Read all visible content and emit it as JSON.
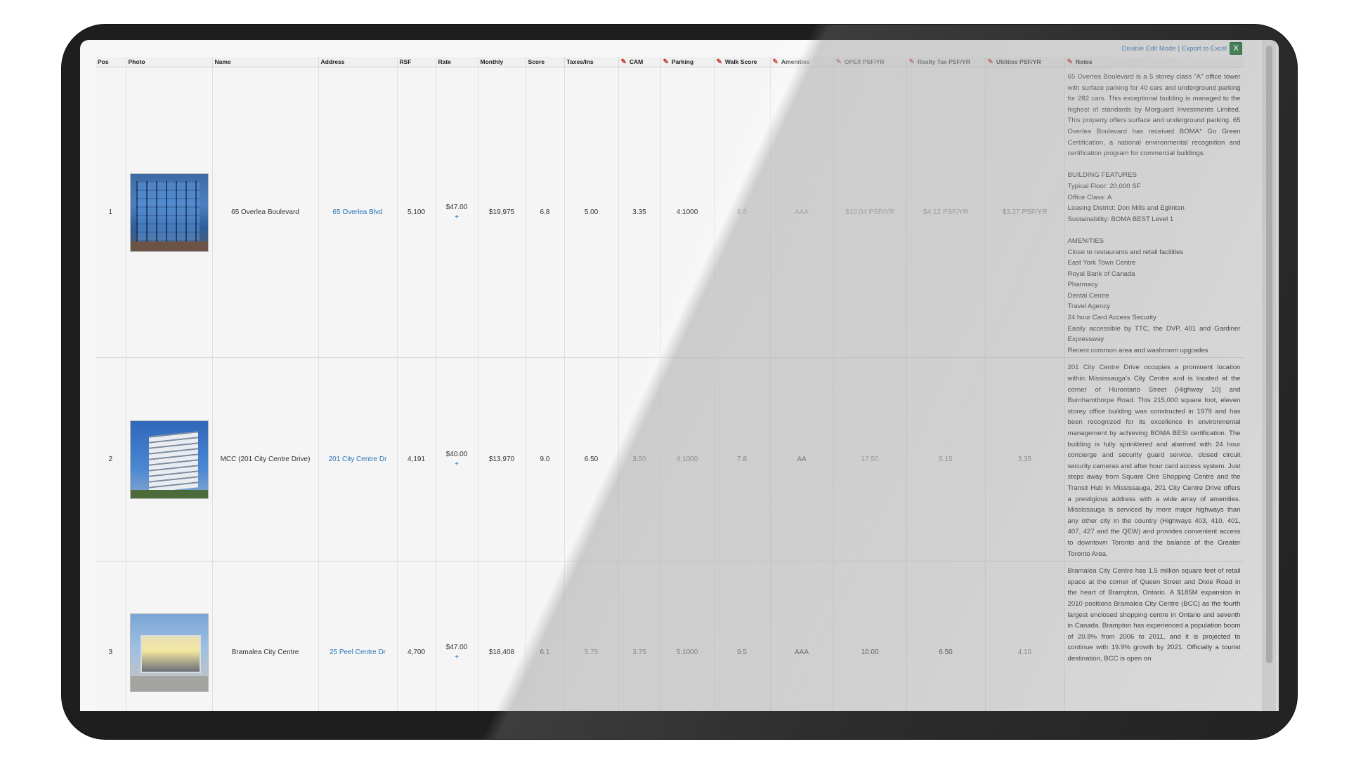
{
  "toolbar": {
    "disable_edit_label": "Disable Edit Mode",
    "separator": "|",
    "export_label": "Export to Excel",
    "export_icon": "excel-icon"
  },
  "columns": {
    "pos": "Pos",
    "photo": "Photo",
    "name": "Name",
    "address": "Address",
    "rsf": "RSF",
    "rate": "Rate",
    "monthly": "Monthly",
    "score": "Score",
    "taxes_ins": "Taxes/Ins",
    "cam": "CAM",
    "parking": "Parking",
    "walk_score": "Walk Score",
    "amenities": "Amenities",
    "opex": "OPEX PSF/YR",
    "realty_tax": "Realty Tax PSF/YR",
    "utilities": "Utilities PSF/YR",
    "notes": "Notes"
  },
  "rows": [
    {
      "pos": "1",
      "name": "65 Overlea Boulevard",
      "address": "65 Overlea Blvd",
      "rsf": "5,100",
      "rate": "$47.00",
      "rate_action": "+",
      "monthly": "$19,975",
      "score": "6.8",
      "taxes_ins": "5.00",
      "cam": "3.35",
      "parking": "4:1000",
      "walk_score": "8.6",
      "amenities": "AAA",
      "opex": "$10.04 PSF/YR",
      "realty_tax": "$4.12 PSF/YR",
      "utilities": "$3.27 PSF/YR",
      "notes": " 65 Overlea Boulevard is a 5 storey class \"A\" office tower with surface parking for 40 cars and underground parking for 282 cars. This exceptional building is managed to the highest of standards by Morguard Investments Limited. This property offers surface and underground parking. 65 Overlea Boulevard has received BOMA* Go Green Certification, a national environmental recognition and certification program for commercial buildings.\n\nBUILDING FEATURES\nTypical Floor: 20,000 SF\nOffice Class: A\nLeasing District: Don Mills and Eglinton\nSustainability: BOMA BEST Level 1\n\nAMENITIES\nClose to restaurants and retail facilities\nEast York Town Centre\nRoyal Bank of Canada\nPharmacy\nDental Centre\nTravel Agency\n24 hour Card Access Security\nEasily accessible by TTC, the DVP, 401 and Gardiner Expressway\nRecent common area and washroom upgrades"
    },
    {
      "pos": "2",
      "name": "MCC (201 City Centre Drive)",
      "address": "201 City Centre Dr",
      "rsf": "4,191",
      "rate": "$40.00",
      "rate_action": "+",
      "monthly": "$13,970",
      "score": "9.0",
      "taxes_ins": "6.50",
      "cam": "3.50",
      "parking": "4:1000",
      "walk_score": "7.8",
      "amenities": "AA",
      "opex": "17.50",
      "realty_tax": "5.15",
      "utilities": "3.35",
      "notes": " 201 City Centre Drive occupies a prominent location within Mississauga's City Centre and is located at the corner of Hurontario Street (Highway 10) and Burnhamthorpe Road. This 215,000 square foot, eleven storey office building was constructed in 1979 and has been recognized for its excellence in environmental management by achieving BOMA BESt certification. The building is fully sprinklered and alarmed with 24 hour concierge and security guard service, closed circuit security cameras and after hour card access system. Just steps away from Square One Shopping Centre and the Transit Hub in Mississauga, 201 City Centre Drive offers a prestigious address with a wide array of amenities. Mississauga is serviced by more major highways than any other city in the country (Highways 403, 410, 401, 407, 427 and the QEW) and provides convenient access to downtown Toronto and the balance of the Greater Toronto Area."
    },
    {
      "pos": "3",
      "name": "Bramalea City Centre",
      "address": "25 Peel Centre Dr",
      "rsf": "4,700",
      "rate": "$47.00",
      "rate_action": "+",
      "monthly": "$18,408",
      "score": "6.1",
      "taxes_ins": "5.75",
      "cam": "3.75",
      "parking": "5:1000",
      "walk_score": "9.5",
      "amenities": "AAA",
      "opex": "10.00",
      "realty_tax": "6.50",
      "utilities": "4.10",
      "notes": " Bramalea City Centre has 1.5 million square feet of retail space at the corner of Queen Street and Dixie Road in the heart of Brampton, Ontario. A $185M expansion in 2010 positions Bramalea City Centre (BCC) as the fourth largest enclosed shopping centre in Ontario and seventh in Canada. Brampton has experienced a population boom of 20.8% from 2006 to 2011, and it is projected to continue with 19.9% growth by 2021. Officially a tourist destination, BCC is open on"
    }
  ]
}
